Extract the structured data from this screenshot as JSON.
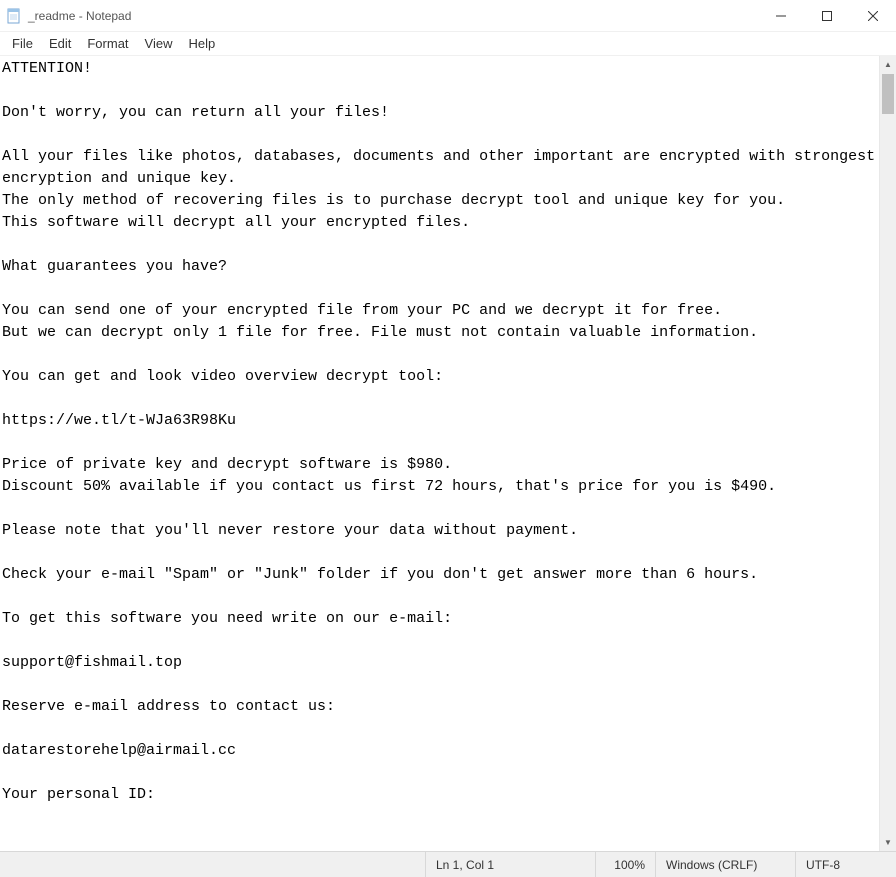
{
  "window": {
    "title": "_readme - Notepad"
  },
  "menu": {
    "file": "File",
    "edit": "Edit",
    "format": "Format",
    "view": "View",
    "help": "Help"
  },
  "content": {
    "text": "ATTENTION!\n\nDon't worry, you can return all your files!\n\nAll your files like photos, databases, documents and other important are encrypted with strongest encryption and unique key.\nThe only method of recovering files is to purchase decrypt tool and unique key for you.\nThis software will decrypt all your encrypted files.\n\nWhat guarantees you have?\n\nYou can send one of your encrypted file from your PC and we decrypt it for free.\nBut we can decrypt only 1 file for free. File must not contain valuable information.\n\nYou can get and look video overview decrypt tool:\n\nhttps://we.tl/t-WJa63R98Ku\n\nPrice of private key and decrypt software is $980.\nDiscount 50% available if you contact us first 72 hours, that's price for you is $490.\n\nPlease note that you'll never restore your data without payment.\n\nCheck your e-mail \"Spam\" or \"Junk\" folder if you don't get answer more than 6 hours.\n\nTo get this software you need write on our e-mail:\n\nsupport@fishmail.top\n\nReserve e-mail address to contact us:\n\ndatarestorehelp@airmail.cc\n\nYour personal ID:\n"
  },
  "status": {
    "position": "Ln 1, Col 1",
    "zoom": "100%",
    "lineEnding": "Windows (CRLF)",
    "encoding": "UTF-8"
  }
}
